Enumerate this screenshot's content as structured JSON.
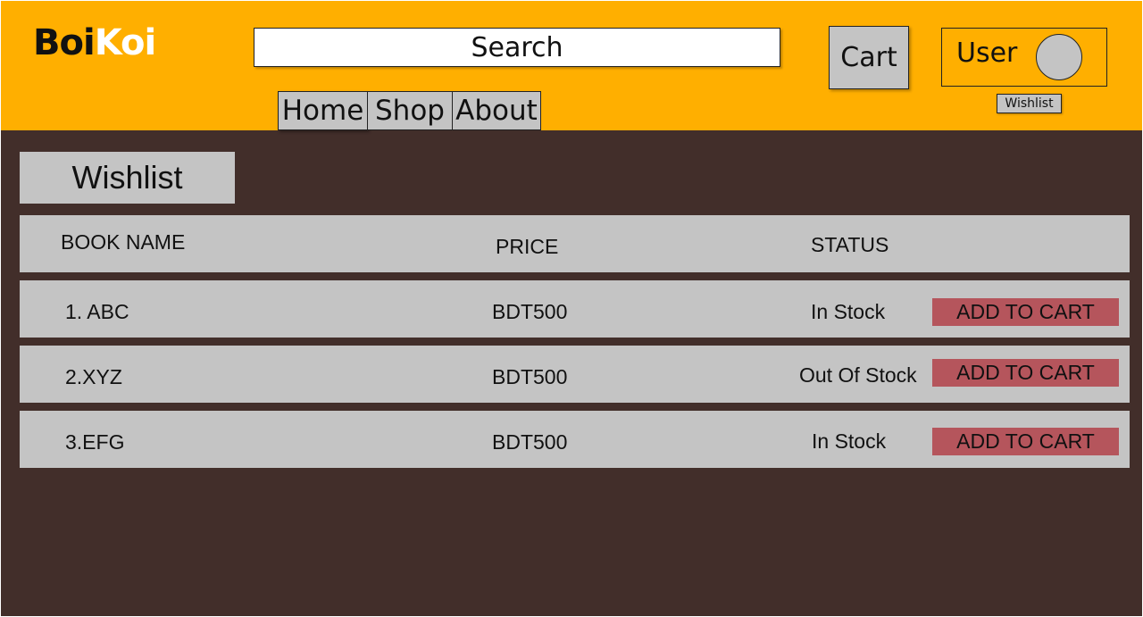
{
  "brand": {
    "logo_part1": "Boi",
    "logo_part2": "Koi"
  },
  "search": {
    "label": "Search"
  },
  "header": {
    "cart_label": "Cart",
    "user_label": "User",
    "wishlist_link": "Wishlist"
  },
  "nav": {
    "items": [
      {
        "label": "Home"
      },
      {
        "label": "Shop"
      },
      {
        "label": "About"
      }
    ]
  },
  "page": {
    "title": "Wishlist"
  },
  "table": {
    "columns": {
      "name": "BOOK NAME",
      "price": "PRICE",
      "status": "STATUS"
    },
    "rows": [
      {
        "name": "1. ABC",
        "price": "BDT500",
        "status": "In Stock",
        "action": "ADD TO CART"
      },
      {
        "name": "2.XYZ",
        "price": "BDT500",
        "status": "Out Of Stock",
        "action": "ADD TO CART"
      },
      {
        "name": "3.EFG",
        "price": "BDT500",
        "status": "In Stock",
        "action": "ADD TO CART"
      }
    ]
  },
  "colors": {
    "header_bg": "#ffaf00",
    "page_bg": "#422e2a",
    "panel_bg": "#c4c4c4",
    "button_red": "#b5555c"
  }
}
